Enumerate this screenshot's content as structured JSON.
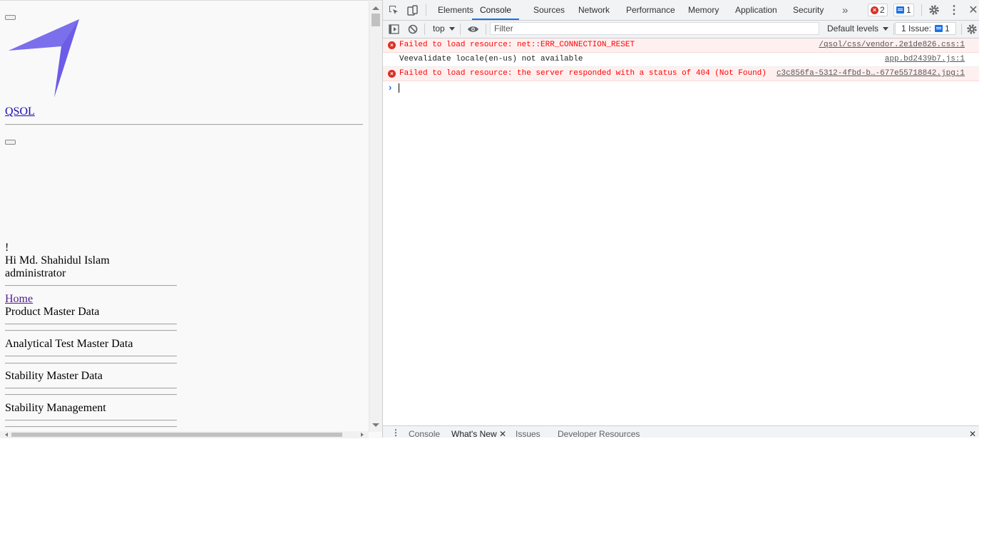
{
  "page": {
    "site_link": "QSOL",
    "greeting_mark": "!",
    "greeting": "Hi Md. Shahidul Islam",
    "role": "administrator",
    "home_link": "Home",
    "menu": [
      "Product Master Data",
      "Analytical Test Master Data",
      "Stability Master Data",
      "Stability Management"
    ],
    "logo_color": "#6c5ce7"
  },
  "devtools": {
    "tabs": [
      "Elements",
      "Console",
      "Sources",
      "Network",
      "Performance",
      "Memory",
      "Application",
      "Security"
    ],
    "active_tab": "Console",
    "error_count": "2",
    "message_count": "1",
    "toolbar": {
      "context": "top",
      "filter_placeholder": "Filter",
      "levels": "Default levels",
      "issues_label": "1 Issue:",
      "issues_count": "1"
    },
    "messages": [
      {
        "level": "error",
        "text": "Failed to load resource: net::ERR_CONNECTION_RESET",
        "source": "/qsol/css/vendor.2e1de826.css:1"
      },
      {
        "level": "info",
        "text": "Veevalidate locale(en-us) not available",
        "source": "app.bd2439b7.js:1"
      },
      {
        "level": "error",
        "text": "Failed to load resource: the server responded with a status of 404 (Not Found)",
        "source": "c3c856fa-5312-4fbd-b…-677e55718842.jpg:1"
      }
    ],
    "drawer_tabs": [
      "Console",
      "What's New",
      "Issues",
      "Developer Resources"
    ],
    "drawer_active": "What's New",
    "colors": {
      "accent": "#1a73e8",
      "error": "#d93025",
      "error_bg": "#fff0f0"
    }
  }
}
